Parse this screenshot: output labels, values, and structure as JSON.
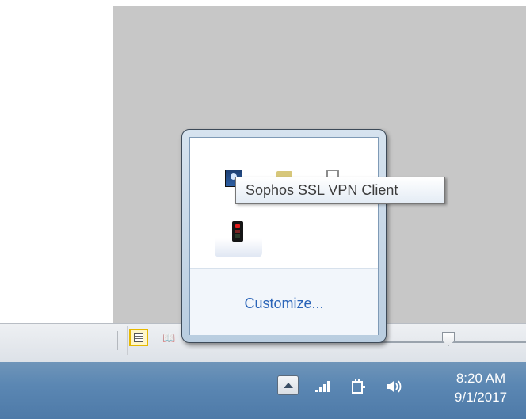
{
  "popup": {
    "customize_label": "Customize...",
    "icons": [
      "vpn-client-icon",
      "folder-icon",
      "flag-icon",
      "traffic-light-icon"
    ]
  },
  "tooltip": {
    "text": "Sophos SSL VPN Client"
  },
  "taskbar": {
    "clock_time": "8:20 AM",
    "clock_date": "9/1/2017",
    "tray_icons": [
      "show-hidden-icons-arrow",
      "network-signal-icon",
      "power-plug-icon",
      "volume-icon"
    ]
  },
  "colors": {
    "taskbar": "#5b87b3",
    "link": "#2a64b8",
    "view_button_highlight": "#e6b800"
  }
}
